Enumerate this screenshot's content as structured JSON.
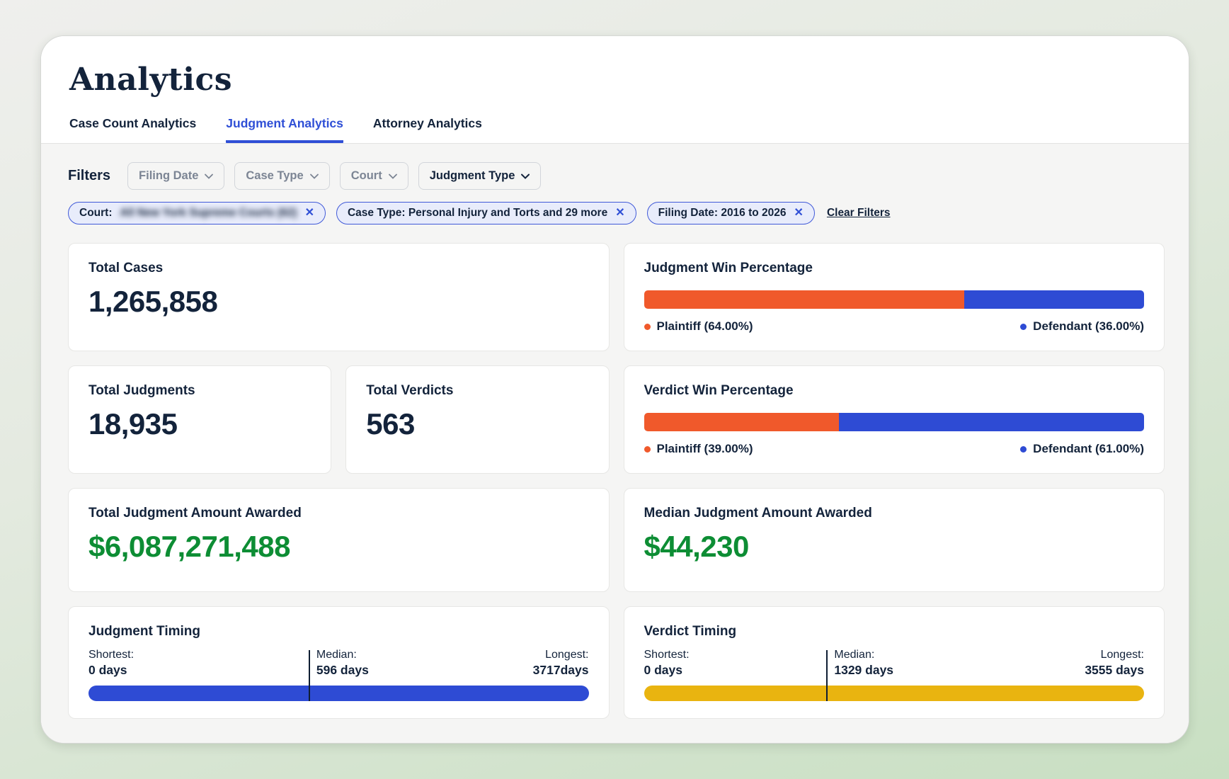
{
  "page": {
    "title": "Analytics"
  },
  "tabs": [
    {
      "label": "Case Count Analytics"
    },
    {
      "label": "Judgment Analytics"
    },
    {
      "label": "Attorney Analytics"
    }
  ],
  "filters": {
    "label": "Filters",
    "dropdowns": [
      {
        "label": "Filing Date"
      },
      {
        "label": "Case Type"
      },
      {
        "label": "Court"
      },
      {
        "label": "Judgment Type"
      }
    ],
    "chips": [
      {
        "prefix": "Court:",
        "value": "All New York Supreme Courts (62)",
        "value_blurred": true
      },
      {
        "label": "Case Type: Personal Injury and Torts and 29 more"
      },
      {
        "label": "Filing Date: 2016 to 2026"
      }
    ],
    "clear_label": "Clear Filters"
  },
  "cards": {
    "total_cases": {
      "title": "Total Cases",
      "value": "1,265,858"
    },
    "judgment_win": {
      "title": "Judgment Win Percentage",
      "plaintiff_pct": 64,
      "defendant_pct": 36,
      "plaintiff_label": "Plaintiff (64.00%)",
      "defendant_label": "Defendant (36.00%)"
    },
    "total_judgments": {
      "title": "Total Judgments",
      "value": "18,935"
    },
    "total_verdicts": {
      "title": "Total Verdicts",
      "value": "563"
    },
    "verdict_win": {
      "title": "Verdict Win Percentage",
      "plaintiff_pct": 39,
      "defendant_pct": 61,
      "plaintiff_label": "Plaintiff (39.00%)",
      "defendant_label": "Defendant (61.00%)"
    },
    "total_amount": {
      "title": "Total Judgment Amount Awarded",
      "value": "$6,087,271,488"
    },
    "median_amount": {
      "title": "Median Judgment Amount Awarded",
      "value": "$44,230"
    },
    "judgment_timing": {
      "title": "Judgment Timing",
      "shortest_label": "Shortest:",
      "shortest": "0 days",
      "median_label": "Median:",
      "median": "596 days",
      "longest_label": "Longest:",
      "longest": "3717days",
      "median_pos_pct": 44
    },
    "verdict_timing": {
      "title": "Verdict Timing",
      "shortest_label": "Shortest:",
      "shortest": "0 days",
      "median_label": "Median:",
      "median": "1329 days",
      "longest_label": "Longest:",
      "longest": "3555 days",
      "median_pos_pct": 36.5
    }
  },
  "colors": {
    "plaintiff": "#f0592b",
    "defendant": "#2e4bd4",
    "judgment_timing_bar": "#2e4bd4",
    "verdict_timing_bar": "#e9b410",
    "accent_blue": "#2f4fd6",
    "money_green": "#0d8d34",
    "navy_text": "#13233b"
  }
}
